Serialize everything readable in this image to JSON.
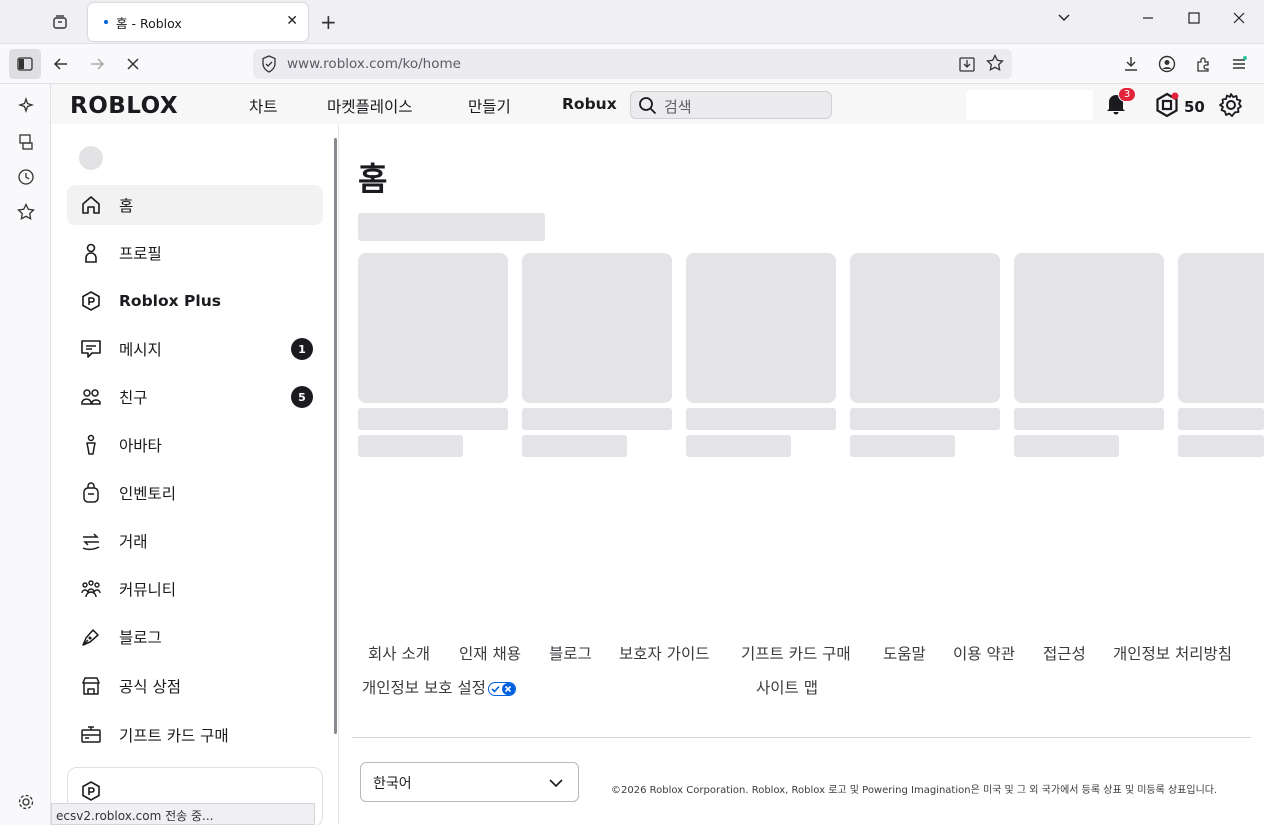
{
  "browser": {
    "tab_title": "홈 - Roblox",
    "url": "www.roblox.com/ko/home",
    "status_text": "ecsv2.roblox.com 전송 중..."
  },
  "header": {
    "logo": "ROBLOX",
    "nav": [
      "차트",
      "마켓플레이스",
      "만들기",
      "Robux"
    ],
    "search_placeholder": "검색",
    "notification_count": "3",
    "robux_balance": "50"
  },
  "sidebar": {
    "items": [
      {
        "label": "홈",
        "icon": "home-icon"
      },
      {
        "label": "프로필",
        "icon": "profile-icon"
      },
      {
        "label": "Roblox Plus",
        "icon": "roblox-plus-icon"
      },
      {
        "label": "메시지",
        "icon": "message-icon",
        "count": "1"
      },
      {
        "label": "친구",
        "icon": "friends-icon",
        "count": "5"
      },
      {
        "label": "아바타",
        "icon": "avatar-icon"
      },
      {
        "label": "인벤토리",
        "icon": "inventory-icon"
      },
      {
        "label": "거래",
        "icon": "trade-icon"
      },
      {
        "label": "커뮤니티",
        "icon": "community-icon"
      },
      {
        "label": "블로그",
        "icon": "blog-icon"
      },
      {
        "label": "공식 상점",
        "icon": "store-icon"
      },
      {
        "label": "기프트 카드 구매",
        "icon": "gift-card-icon"
      }
    ]
  },
  "main": {
    "title": "홈"
  },
  "footer": {
    "links_row1": [
      "회사 소개",
      "인재 채용",
      "블로그",
      "보호자 가이드",
      "기프트 카드 구매",
      "도움말",
      "이용 약관",
      "접근성",
      "개인정보 처리방침"
    ],
    "links_row2": [
      "개인정보 보호 설정",
      "사이트 맵"
    ],
    "language": "한국어",
    "copyright": "©2026 Roblox Corporation. Roblox, Roblox 로고 및 Powering Imagination은 미국 및 그 외 국가에서 등록 상표 및 미등록 상표입니다."
  },
  "colors": {
    "accent": "#0060df",
    "badge_red": "#e0243a",
    "skeleton": "#e3e3e8"
  }
}
